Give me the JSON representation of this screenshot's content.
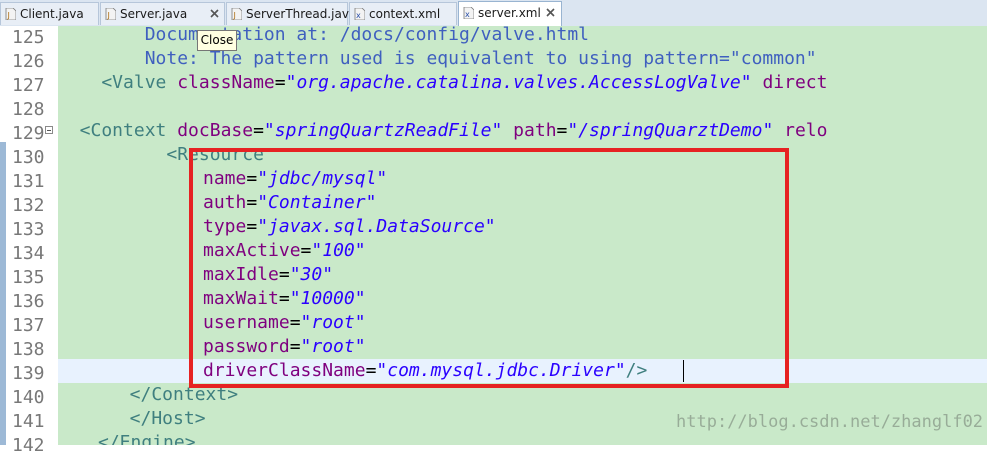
{
  "tabs": [
    {
      "label": "Client.java",
      "icon": "java-file-icon",
      "active": false
    },
    {
      "label": "Server.java",
      "icon": "java-file-icon",
      "active": false
    },
    {
      "label": "ServerThread.java",
      "icon": "java-file-icon",
      "active": false
    },
    {
      "label": "context.xml",
      "icon": "xml-file-icon",
      "active": false
    },
    {
      "label": "server.xml",
      "icon": "xml-file-icon",
      "active": true
    }
  ],
  "tooltip": "Close",
  "lines": [
    {
      "num": "125",
      "segments": [
        {
          "t": "        Documentation at: /docs/config/valve.html",
          "c": "kw-cm"
        }
      ]
    },
    {
      "num": "126",
      "segments": [
        {
          "t": "        Note: The pattern used is equivalent to using pattern=\"common\"",
          "c": "kw-cm"
        }
      ]
    },
    {
      "num": "127",
      "segments": [
        {
          "t": "    <Valve ",
          "c": "kw-tag"
        },
        {
          "t": "className",
          "c": "kw-attr"
        },
        {
          "t": "=",
          "c": "kw-pl"
        },
        {
          "t": "\"org.apache.catalina.valves.AccessLogValve\"",
          "c": "kw-val"
        },
        {
          "t": " direct",
          "c": "kw-attr"
        }
      ]
    },
    {
      "num": "128",
      "segments": [
        {
          "t": "",
          "c": "kw-pl"
        }
      ]
    },
    {
      "num": "129",
      "segments": [
        {
          "t": "  <Context ",
          "c": "kw-tag"
        },
        {
          "t": "docBase",
          "c": "kw-attr"
        },
        {
          "t": "=",
          "c": "kw-pl"
        },
        {
          "t": "\"springQuartzReadFile\"",
          "c": "kw-val"
        },
        {
          "t": " path",
          "c": "kw-attr"
        },
        {
          "t": "=",
          "c": "kw-pl"
        },
        {
          "t": "\"/springQuarztDemo\"",
          "c": "kw-val"
        },
        {
          "t": " relo",
          "c": "kw-attr"
        }
      ]
    },
    {
      "num": "130",
      "segments": [
        {
          "t": "          <Resource",
          "c": "kw-tag"
        }
      ]
    },
    {
      "num": "131",
      "segments": [
        {
          "t": "name",
          "c": "kw-attr"
        },
        {
          "t": "=",
          "c": "kw-pl"
        },
        {
          "t": "\"jdbc/mysql\"",
          "c": "kw-val"
        }
      ]
    },
    {
      "num": "132",
      "segments": [
        {
          "t": "auth",
          "c": "kw-attr"
        },
        {
          "t": "=",
          "c": "kw-pl"
        },
        {
          "t": "\"Container\"",
          "c": "kw-val"
        }
      ]
    },
    {
      "num": "133",
      "segments": [
        {
          "t": "type",
          "c": "kw-attr"
        },
        {
          "t": "=",
          "c": "kw-pl"
        },
        {
          "t": "\"javax.sql.DataSource\"",
          "c": "kw-val"
        }
      ]
    },
    {
      "num": "134",
      "segments": [
        {
          "t": "maxActive",
          "c": "kw-attr"
        },
        {
          "t": "=",
          "c": "kw-pl"
        },
        {
          "t": "\"100\"",
          "c": "kw-val"
        }
      ]
    },
    {
      "num": "135",
      "segments": [
        {
          "t": "maxIdle",
          "c": "kw-attr"
        },
        {
          "t": "=",
          "c": "kw-pl"
        },
        {
          "t": "\"30\"",
          "c": "kw-val"
        }
      ]
    },
    {
      "num": "136",
      "segments": [
        {
          "t": "maxWait",
          "c": "kw-attr"
        },
        {
          "t": "=",
          "c": "kw-pl"
        },
        {
          "t": "\"10000\"",
          "c": "kw-val"
        }
      ]
    },
    {
      "num": "137",
      "segments": [
        {
          "t": "username",
          "c": "kw-attr"
        },
        {
          "t": "=",
          "c": "kw-pl"
        },
        {
          "t": "\"root\"",
          "c": "kw-val"
        }
      ]
    },
    {
      "num": "138",
      "segments": [
        {
          "t": "password",
          "c": "kw-attr"
        },
        {
          "t": "=",
          "c": "kw-pl"
        },
        {
          "t": "\"root\"",
          "c": "kw-val"
        }
      ]
    },
    {
      "num": "139",
      "segments": [
        {
          "t": "driverClassName",
          "c": "kw-attr"
        },
        {
          "t": "=",
          "c": "kw-pl"
        },
        {
          "t": "\"com.mysql.jdbc.Driver\"",
          "c": "kw-val"
        },
        {
          "t": "/>",
          "c": "kw-tag"
        }
      ]
    },
    {
      "num": "140",
      "segments": [
        {
          "t": "  </Context>",
          "c": "kw-tag"
        }
      ]
    },
    {
      "num": "141",
      "segments": [
        {
          "t": "  </Host>",
          "c": "kw-tag"
        }
      ]
    },
    {
      "num": "142",
      "segments": [
        {
          "t": "</Engine>",
          "c": "kw-tag"
        }
      ]
    }
  ],
  "watermark": "http://blog.csdn.net/zhanglf02",
  "colors": {
    "editor_bg": "#c9e9c9",
    "highlight_box": "#e62222",
    "current_line": "#e8f2fe",
    "tag": "#3f7f7f",
    "attribute": "#7f007f",
    "value": "#2a00ff",
    "comment": "#3f5fbf"
  }
}
